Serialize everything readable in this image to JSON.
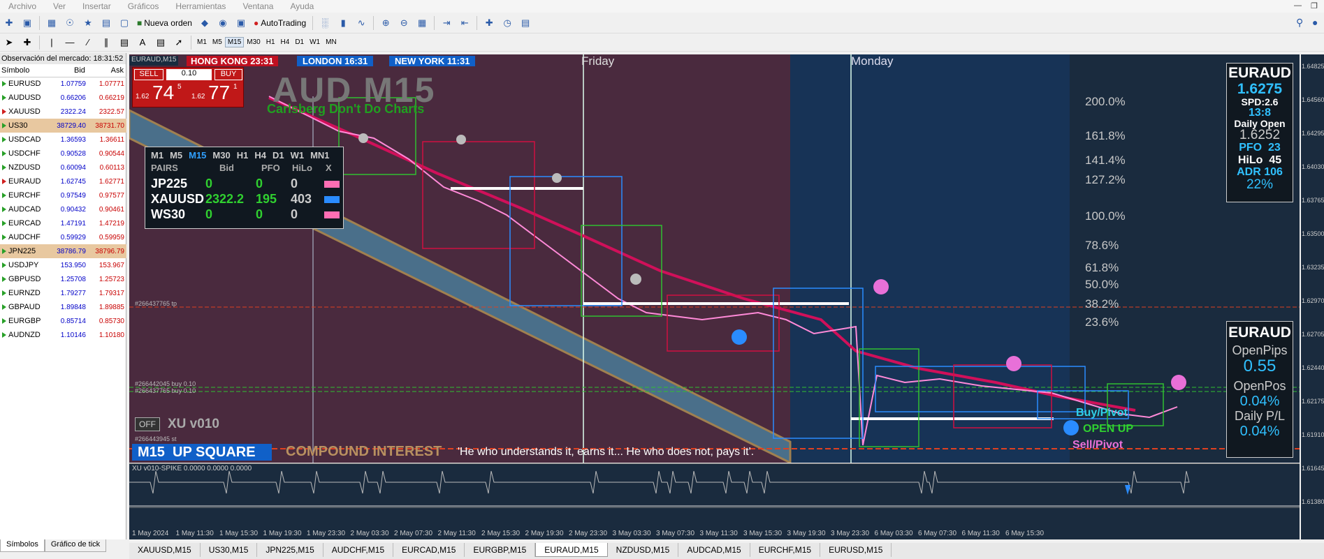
{
  "menu": [
    "Archivo",
    "Ver",
    "Insertar",
    "Gráficos",
    "Herramientas",
    "Ventana",
    "Ayuda"
  ],
  "toolbar": {
    "new_order": "Nueva orden",
    "autotrading": "AutoTrading"
  },
  "timeframes": [
    "M1",
    "M5",
    "M15",
    "M30",
    "H1",
    "H4",
    "D1",
    "W1",
    "MN"
  ],
  "market": {
    "title": "Observación del mercado: 18:31:52",
    "col_symbol": "Símbolo",
    "col_bid": "Bid",
    "col_ask": "Ask",
    "rows": [
      {
        "s": "EURUSD",
        "b": "1.07759",
        "a": "1.07771",
        "d": "up",
        "hl": false
      },
      {
        "s": "AUDUSD",
        "b": "0.66206",
        "a": "0.66219",
        "d": "up",
        "hl": false
      },
      {
        "s": "XAUUSD",
        "b": "2322.24",
        "a": "2322.57",
        "d": "dn",
        "hl": false
      },
      {
        "s": "US30",
        "b": "38729.40",
        "a": "38731.70",
        "d": "up",
        "hl": true
      },
      {
        "s": "USDCAD",
        "b": "1.36593",
        "a": "1.36611",
        "d": "up",
        "hl": false
      },
      {
        "s": "USDCHF",
        "b": "0.90528",
        "a": "0.90544",
        "d": "up",
        "hl": false
      },
      {
        "s": "NZDUSD",
        "b": "0.60094",
        "a": "0.60113",
        "d": "up",
        "hl": false
      },
      {
        "s": "EURAUD",
        "b": "1.62745",
        "a": "1.62771",
        "d": "dn",
        "hl": false
      },
      {
        "s": "EURCHF",
        "b": "0.97549",
        "a": "0.97577",
        "d": "up",
        "hl": false
      },
      {
        "s": "AUDCAD",
        "b": "0.90432",
        "a": "0.90461",
        "d": "up",
        "hl": false
      },
      {
        "s": "EURCAD",
        "b": "1.47191",
        "a": "1.47219",
        "d": "up",
        "hl": false
      },
      {
        "s": "AUDCHF",
        "b": "0.59929",
        "a": "0.59959",
        "d": "up",
        "hl": false
      },
      {
        "s": "JPN225",
        "b": "38786.79",
        "a": "38796.79",
        "d": "up",
        "hl": true
      },
      {
        "s": "USDJPY",
        "b": "153.950",
        "a": "153.967",
        "d": "up",
        "hl": false
      },
      {
        "s": "GBPUSD",
        "b": "1.25708",
        "a": "1.25723",
        "d": "up",
        "hl": false
      },
      {
        "s": "EURNZD",
        "b": "1.79277",
        "a": "1.79317",
        "d": "up",
        "hl": false
      },
      {
        "s": "GBPAUD",
        "b": "1.89848",
        "a": "1.89885",
        "d": "up",
        "hl": false
      },
      {
        "s": "EURGBP",
        "b": "0.85714",
        "a": "0.85730",
        "d": "up",
        "hl": false
      },
      {
        "s": "AUDNZD",
        "b": "1.10146",
        "a": "1.10180",
        "d": "up",
        "hl": false
      }
    ],
    "tabs": [
      "Símbolos",
      "Gráfico de tick"
    ]
  },
  "chart": {
    "corner": "EURAUD,M15",
    "sessions": [
      {
        "city": "HONG KONG",
        "time": "23:31"
      },
      {
        "city": "LONDON",
        "time": "16:31"
      },
      {
        "city": "NEW YORK",
        "time": "11:31"
      }
    ],
    "sell": "SELL",
    "buy": "BUY",
    "lots": "0.10",
    "sell_big": "74",
    "sell_small": "1.62",
    "sell_sup": "5",
    "buy_big": "77",
    "buy_small": "1.62",
    "buy_sup": "1",
    "title": "AUD M15",
    "subtitle": "Carlsberg Don't Do Charts",
    "day1": "Friday",
    "day2": "Monday",
    "fibs": [
      "200.0%",
      "161.8%",
      "141.4%",
      "127.2%",
      "100.0%",
      "78.6%",
      "61.8%",
      "50.0%",
      "38.2%",
      "23.6%"
    ],
    "order_tp": "#266437765 tp",
    "order_buy1": "#266442045 buy 0.10",
    "order_buy2": "#266437765 buy 0.10",
    "order_small": "#266443945 st",
    "off": "OFF",
    "version": "XU v010",
    "m15": "M15",
    "up_square": "UP SQUARE",
    "compound": "COMPOUND INTEREST",
    "quote": "'He who understands it, earns it... He who does not, pays it'.",
    "buy_pivot": "Buy/Pivot",
    "open_up": "OPEN UP",
    "sell_pivot": "Sell/Pivot"
  },
  "pairs_panel": {
    "tfs": [
      "M1",
      "M5",
      "M15",
      "M30",
      "H1",
      "H4",
      "D1",
      "W1",
      "MN1"
    ],
    "headers": [
      "PAIRS",
      "Bid",
      "PFO",
      "HiLo",
      "X"
    ],
    "rows": [
      {
        "p": "JP225",
        "bid": "0",
        "pfo": "0",
        "hilo": "0",
        "c": "#ff6eb4"
      },
      {
        "p": "XAUUSD",
        "bid": "2322.2",
        "pfo": "195",
        "hilo": "403",
        "c": "#2a8cff"
      },
      {
        "p": "WS30",
        "bid": "0",
        "pfo": "0",
        "hilo": "0",
        "c": "#ff6eb4"
      }
    ]
  },
  "info1": {
    "pair": "EURAUD",
    "price": "1.6275",
    "spd": "SPD:2.6",
    "time": "13:8",
    "daily_open_label": "Daily Open",
    "daily_open": "1.6252",
    "pfo_label": "PFO",
    "pfo": "23",
    "hilo_label": "HiLo",
    "hilo": "45",
    "adr_label": "ADR",
    "adr": "106",
    "pct": "22%"
  },
  "info2": {
    "pair": "EURAUD",
    "open_pips_label": "OpenPips",
    "open_pips": "0.55",
    "open_pos_label": "OpenPos",
    "open_pos": "0.04%",
    "daily_pl_label": "Daily P/L",
    "daily_pl": "0.04%"
  },
  "indicator": {
    "label": "XU v010-SPIKE 0.0000 0.0000 0.0000"
  },
  "price_scale": [
    "1.64825",
    "1.64560",
    "1.64295",
    "1.64030",
    "1.63765",
    "1.63500",
    "1.63235",
    "1.62970",
    "1.62705",
    "1.62440",
    "1.62175",
    "1.61910",
    "1.61645",
    "1.61380"
  ],
  "time_scale": [
    "1 May 2024",
    "1 May 11:30",
    "1 May 15:30",
    "1 May 19:30",
    "1 May 23:30",
    "2 May 03:30",
    "2 May 07:30",
    "2 May 11:30",
    "2 May 15:30",
    "2 May 19:30",
    "2 May 23:30",
    "3 May 03:30",
    "3 May 07:30",
    "3 May 11:30",
    "3 May 15:30",
    "3 May 19:30",
    "3 May 23:30",
    "6 May 03:30",
    "6 May 07:30",
    "6 May 11:30",
    "6 May 15:30"
  ],
  "chart_tabs": [
    "XAUUSD,M15",
    "US30,M15",
    "JPN225,M15",
    "AUDCHF,M15",
    "EURCAD,M15",
    "EURGBP,M15",
    "EURAUD,M15",
    "NZDUSD,M15",
    "AUDCAD,M15",
    "EURCHF,M15",
    "EURUSD,M15"
  ],
  "active_chart_tab": "EURAUD,M15"
}
